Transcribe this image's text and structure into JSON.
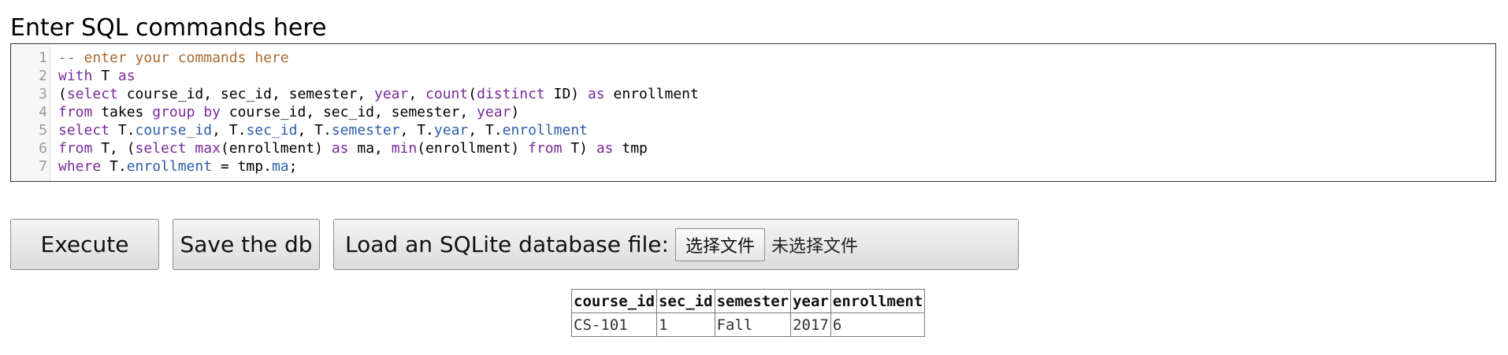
{
  "heading": "Enter SQL commands here",
  "editor": {
    "lines": [
      {
        "num": "1",
        "tokens": [
          {
            "t": "-- enter your commands here",
            "c": "cm"
          }
        ]
      },
      {
        "num": "2",
        "tokens": [
          {
            "t": "with",
            "c": "kw"
          },
          {
            "t": " T ",
            "c": "p"
          },
          {
            "t": "as",
            "c": "kw"
          }
        ]
      },
      {
        "num": "3",
        "tokens": [
          {
            "t": "(",
            "c": "p"
          },
          {
            "t": "select",
            "c": "kw"
          },
          {
            "t": " course_id, sec_id, semester, ",
            "c": "p"
          },
          {
            "t": "year",
            "c": "kw"
          },
          {
            "t": ", ",
            "c": "p"
          },
          {
            "t": "count",
            "c": "fn"
          },
          {
            "t": "(",
            "c": "p"
          },
          {
            "t": "distinct",
            "c": "kw"
          },
          {
            "t": " ID) ",
            "c": "p"
          },
          {
            "t": "as",
            "c": "kw"
          },
          {
            "t": " enrollment",
            "c": "p"
          }
        ]
      },
      {
        "num": "4",
        "tokens": [
          {
            "t": "from",
            "c": "kw"
          },
          {
            "t": " takes ",
            "c": "p"
          },
          {
            "t": "group by",
            "c": "kw"
          },
          {
            "t": " course_id, sec_id, semester, ",
            "c": "p"
          },
          {
            "t": "year",
            "c": "kw"
          },
          {
            "t": ")",
            "c": "p"
          }
        ]
      },
      {
        "num": "5",
        "tokens": [
          {
            "t": "select",
            "c": "kw"
          },
          {
            "t": " T.",
            "c": "p"
          },
          {
            "t": "course_id",
            "c": "pr"
          },
          {
            "t": ", T.",
            "c": "p"
          },
          {
            "t": "sec_id",
            "c": "pr"
          },
          {
            "t": ", T.",
            "c": "p"
          },
          {
            "t": "semester",
            "c": "pr"
          },
          {
            "t": ", T.",
            "c": "p"
          },
          {
            "t": "year",
            "c": "pr"
          },
          {
            "t": ", T.",
            "c": "p"
          },
          {
            "t": "enrollment",
            "c": "pr"
          }
        ]
      },
      {
        "num": "6",
        "tokens": [
          {
            "t": "from",
            "c": "kw"
          },
          {
            "t": " T, (",
            "c": "p"
          },
          {
            "t": "select",
            "c": "kw"
          },
          {
            "t": " ",
            "c": "p"
          },
          {
            "t": "max",
            "c": "fn"
          },
          {
            "t": "(enrollment) ",
            "c": "p"
          },
          {
            "t": "as",
            "c": "kw"
          },
          {
            "t": " ma, ",
            "c": "p"
          },
          {
            "t": "min",
            "c": "fn"
          },
          {
            "t": "(enrollment) ",
            "c": "p"
          },
          {
            "t": "from",
            "c": "kw"
          },
          {
            "t": " T) ",
            "c": "p"
          },
          {
            "t": "as",
            "c": "kw"
          },
          {
            "t": " tmp",
            "c": "p"
          }
        ]
      },
      {
        "num": "7",
        "tokens": [
          {
            "t": "where",
            "c": "kw"
          },
          {
            "t": " T.",
            "c": "p"
          },
          {
            "t": "enrollment",
            "c": "pr"
          },
          {
            "t": " = tmp.",
            "c": "p"
          },
          {
            "t": "ma",
            "c": "pr"
          },
          {
            "t": ";",
            "c": "p"
          }
        ]
      }
    ]
  },
  "buttons": {
    "execute": "Execute",
    "save": "Save the db",
    "load_label": "Load an SQLite database file:",
    "choose_file": "选择文件",
    "no_file": "未选择文件"
  },
  "result": {
    "columns": [
      "course_id",
      "sec_id",
      "semester",
      "year",
      "enrollment"
    ],
    "rows": [
      [
        "CS-101",
        "1",
        "Fall",
        "2017",
        "6"
      ]
    ]
  },
  "colors": {
    "comment": "#a86a32",
    "keyword": "#7a2a9a",
    "property": "#2c5fa8"
  }
}
